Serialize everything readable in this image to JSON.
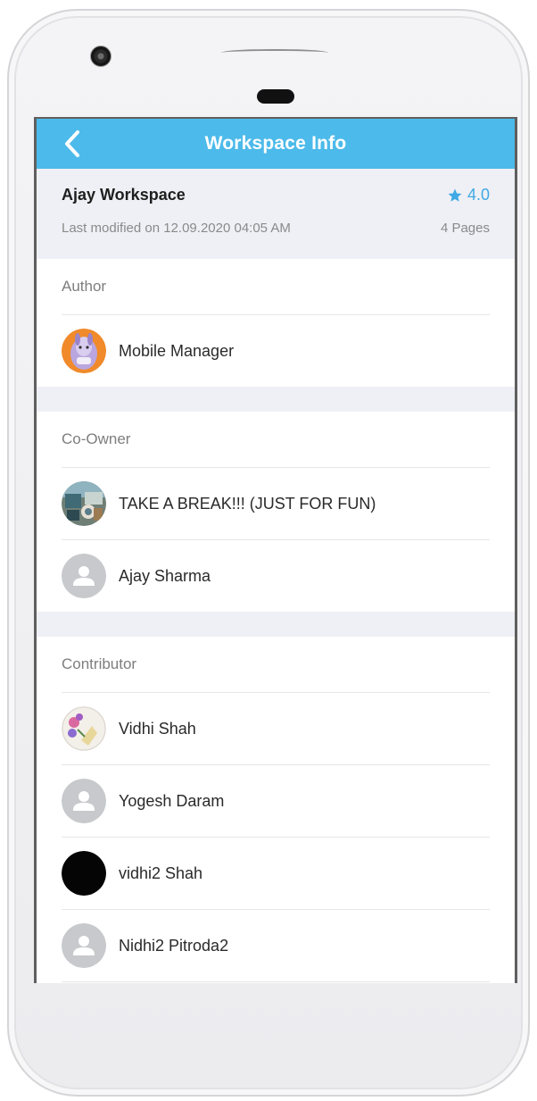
{
  "nav": {
    "title": "Workspace Info",
    "back_icon": "chevron-left-icon"
  },
  "workspace": {
    "name": "Ajay Workspace",
    "rating": "4.0",
    "modified": "Last modified on 12.09.2020 04:05 AM",
    "pages": "4 Pages"
  },
  "sections": {
    "author": {
      "title": "Author",
      "people": [
        {
          "name": "Mobile Manager",
          "avatar": "purple-cartoon-avatar"
        }
      ]
    },
    "co_owner": {
      "title": "Co-Owner",
      "people": [
        {
          "name": "TAKE A BREAK!!! (JUST FOR FUN)",
          "avatar": "photo-avatar"
        },
        {
          "name": "Ajay Sharma",
          "avatar": "default-user-avatar"
        }
      ]
    },
    "contributor": {
      "title": "Contributor",
      "people": [
        {
          "name": "Vidhi Shah",
          "avatar": "flower-photo-avatar"
        },
        {
          "name": "Yogesh Daram",
          "avatar": "default-user-avatar"
        },
        {
          "name": "vidhi2 Shah",
          "avatar": "black-avatar"
        },
        {
          "name": "Nidhi2 Pitroda2",
          "avatar": "default-user-avatar"
        }
      ]
    }
  },
  "colors": {
    "accent": "#4cbaea",
    "rating": "#3fa9e4",
    "header_bg": "#eff0f5"
  }
}
